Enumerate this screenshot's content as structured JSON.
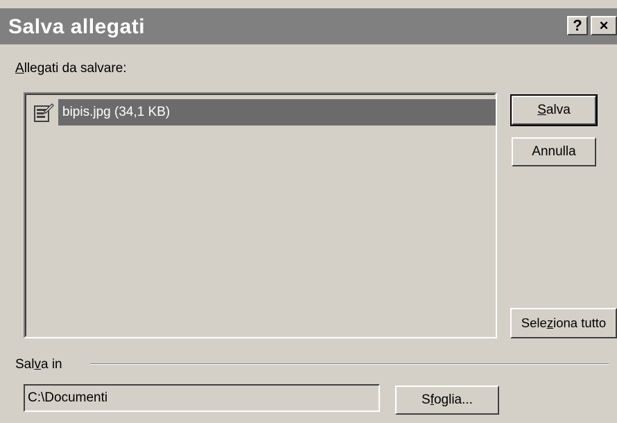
{
  "window": {
    "title": "Salva allegati",
    "help_glyph": "?",
    "close_glyph": "×"
  },
  "attachments": {
    "label_prefix": "",
    "label_mnemonic": "A",
    "label_rest": "llegati da salvare:",
    "items": [
      {
        "text": "bipis.jpg (34,1 KB)",
        "icon": "image-file-icon",
        "selected": true
      }
    ]
  },
  "buttons": {
    "salva": {
      "pre": "",
      "mnemonic": "S",
      "post": "alva"
    },
    "annulla": {
      "label": "Annulla"
    },
    "seleziona_tutto": {
      "pre": "Sele",
      "mnemonic": "z",
      "post": "iona tutto"
    },
    "sfoglia": {
      "pre": "S",
      "mnemonic": "f",
      "post": "oglia..."
    }
  },
  "save_in": {
    "label_pre": "Sal",
    "label_mnemonic": "v",
    "label_post": "a in",
    "path": "C:\\Documenti"
  },
  "colors": {
    "face": "#d4d0c8",
    "titlebar": "#808080",
    "selection": "#6b6b6b"
  }
}
